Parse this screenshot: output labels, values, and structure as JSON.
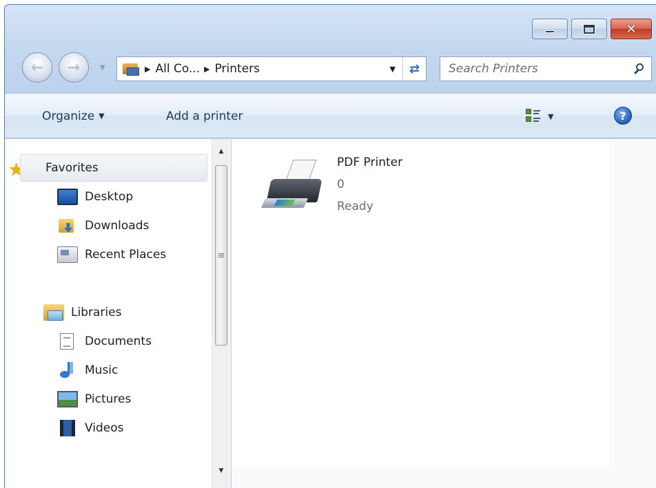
{
  "window": {
    "minimize_icon": "minimize-icon",
    "maximize_icon": "maximize-icon",
    "close_label": "✕"
  },
  "nav": {
    "back_icon": "back-arrow-icon",
    "forward_icon": "forward-arrow-icon"
  },
  "address": {
    "crumbs": [
      "All Co...",
      "Printers"
    ],
    "refresh_icon": "refresh-icon"
  },
  "search": {
    "placeholder": "Search Printers"
  },
  "toolbar": {
    "organize_label": "Organize",
    "add_printer_label": "Add a printer",
    "help_label": "?"
  },
  "sidebar": {
    "favorites": "Favorites",
    "favorite_items": [
      "Desktop",
      "Downloads",
      "Recent Places"
    ],
    "libraries": "Libraries",
    "library_items": [
      "Documents",
      "Music",
      "Pictures",
      "Videos"
    ]
  },
  "printers": [
    {
      "name": "PDF Printer",
      "documents": "0",
      "status": "Ready"
    }
  ],
  "colors": {
    "window_frame": "#bcd2ec",
    "close_button": "#c23b21",
    "link_text": "#1e395b",
    "secondary_text": "#6d6d6d"
  }
}
